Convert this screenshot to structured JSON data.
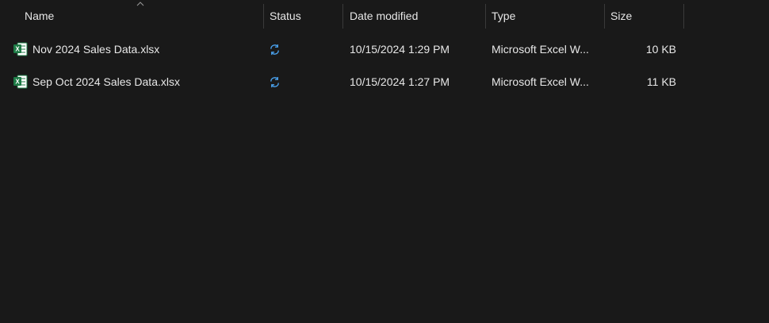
{
  "columns": {
    "name": "Name",
    "status": "Status",
    "date_modified": "Date modified",
    "type": "Type",
    "size": "Size"
  },
  "sort": {
    "column": "name",
    "direction": "ascending"
  },
  "files": [
    {
      "name": "Nov 2024 Sales Data.xlsx",
      "status_icon": "sync-icon",
      "date_modified": "10/15/2024 1:29 PM",
      "type": "Microsoft Excel W...",
      "size": "10 KB"
    },
    {
      "name": "Sep Oct 2024 Sales Data.xlsx",
      "status_icon": "sync-icon",
      "date_modified": "10/15/2024 1:27 PM",
      "type": "Microsoft Excel W...",
      "size": "11 KB"
    }
  ],
  "colors": {
    "background": "#191919",
    "text": "#e8e8e8",
    "sync_blue": "#4aa3f0",
    "excel_green": "#1d7a45"
  }
}
